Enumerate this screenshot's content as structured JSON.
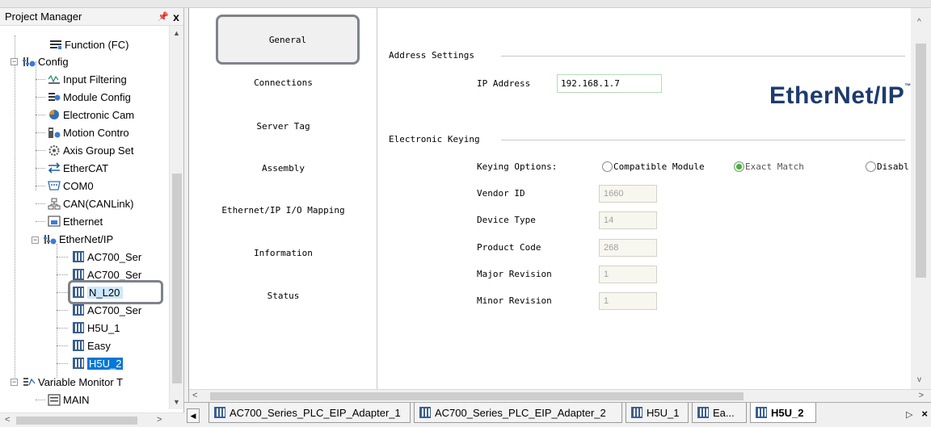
{
  "project_panel": {
    "title": "Project Manager",
    "pin_icon": "pin-icon",
    "close_label": "x",
    "tree": [
      {
        "label": "Function (FC)",
        "icon": "function-icon"
      },
      {
        "label": "Config",
        "icon": "config-icon",
        "expanded": true
      },
      {
        "label": "Input Filtering",
        "icon": "filter-icon"
      },
      {
        "label": "Module Config",
        "icon": "module-config-icon"
      },
      {
        "label": "Electronic Cam",
        "icon": "cam-icon"
      },
      {
        "label": "Motion Contro",
        "icon": "motion-icon"
      },
      {
        "label": "Axis Group Set",
        "icon": "axis-group-icon"
      },
      {
        "label": "EtherCAT",
        "icon": "ethercat-icon"
      },
      {
        "label": "COM0",
        "icon": "serial-port-icon"
      },
      {
        "label": "CAN(CANLink)",
        "icon": "can-icon"
      },
      {
        "label": "Ethernet",
        "icon": "ethernet-icon"
      },
      {
        "label": "EtherNet/IP",
        "icon": "ethernet-ip-icon",
        "expanded": true
      },
      {
        "label": "AC700_Ser",
        "icon": "device-icon"
      },
      {
        "label": "AC700_Ser",
        "icon": "device-icon"
      },
      {
        "label": "N_L20",
        "icon": "device-icon",
        "selected": true
      },
      {
        "label": "AC700_Ser",
        "icon": "device-icon"
      },
      {
        "label": "H5U_1",
        "icon": "device-icon"
      },
      {
        "label": "Easy",
        "icon": "device-icon"
      },
      {
        "label": "H5U_2",
        "icon": "device-icon",
        "active": true
      },
      {
        "label": "Variable Monitor T",
        "icon": "variable-monitor-icon",
        "expanded": true
      },
      {
        "label": "MAIN",
        "icon": "table-icon"
      }
    ]
  },
  "nav": {
    "items": [
      {
        "label": "General",
        "active": true
      },
      {
        "label": "Connections"
      },
      {
        "label": "Server Tag"
      },
      {
        "label": "Assembly"
      },
      {
        "label": "Ethernet/IP I/O Mapping"
      },
      {
        "label": "Information"
      },
      {
        "label": "Status"
      }
    ]
  },
  "general": {
    "address_section": "Address Settings",
    "ip_label": "IP Address",
    "ip_value": "192.168.1.7",
    "keying_section": "Electronic Keying",
    "keying_label": "Keying Options:",
    "keying_options": [
      {
        "label": "Compatible Module",
        "selected": false
      },
      {
        "label": "Exact Match",
        "selected": true
      },
      {
        "label": "Disabl",
        "selected": false
      }
    ],
    "fields": [
      {
        "label": "Vendor ID",
        "value": "1660"
      },
      {
        "label": "Device Type",
        "value": "14"
      },
      {
        "label": "Product Code",
        "value": "268"
      },
      {
        "label": "Major Revision",
        "value": "1"
      },
      {
        "label": "Minor Revision",
        "value": "1"
      }
    ],
    "logo_text": "EtherNet/IP",
    "logo_mark": "™"
  },
  "tabs": [
    {
      "label": "AC700_Series_PLC_EIP_Adapter_1",
      "icon": "device-icon"
    },
    {
      "label": "AC700_Series_PLC_EIP_Adapter_2",
      "icon": "device-icon"
    },
    {
      "label": "H5U_1",
      "icon": "device-icon"
    },
    {
      "label": "Ea...",
      "icon": "device-icon"
    },
    {
      "label": "H5U_2",
      "icon": "device-icon",
      "active": true
    }
  ],
  "colors": {
    "selection": "#cde8ff",
    "active_item": "#0078d7",
    "logo": "#1d3b6e",
    "radio_selected": "#4caf3f"
  }
}
